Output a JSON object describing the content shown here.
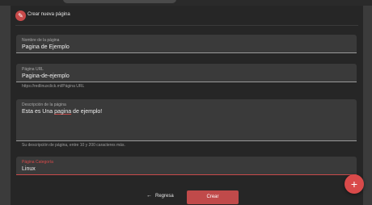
{
  "header": {
    "title": "Crear nueva página",
    "avatar_icon": "logo-icon"
  },
  "fields": {
    "name": {
      "label": "Nombre de la página",
      "value": "Pagina de Ejemplo"
    },
    "url": {
      "label": "Página URL",
      "value": "Pagina-de-ejemplo",
      "hint": "https://redlinuxclick.ml/Página URL"
    },
    "description": {
      "label": "Descripción de la página",
      "value_prefix": "Esta es Una ",
      "value_underlined": "pagina",
      "value_suffix": " de ejemplo!",
      "hint": "Su descripción de página, entre 10 y 200 caracteres más."
    },
    "category": {
      "label": "Página Categoría",
      "value": "Linux"
    }
  },
  "actions": {
    "back_label": "Regresa",
    "create_label": "Crear",
    "fab_icon": "plus-icon"
  },
  "colors": {
    "accent": "#c84a4a",
    "background": "#262626",
    "field": "#3a3a3a"
  }
}
